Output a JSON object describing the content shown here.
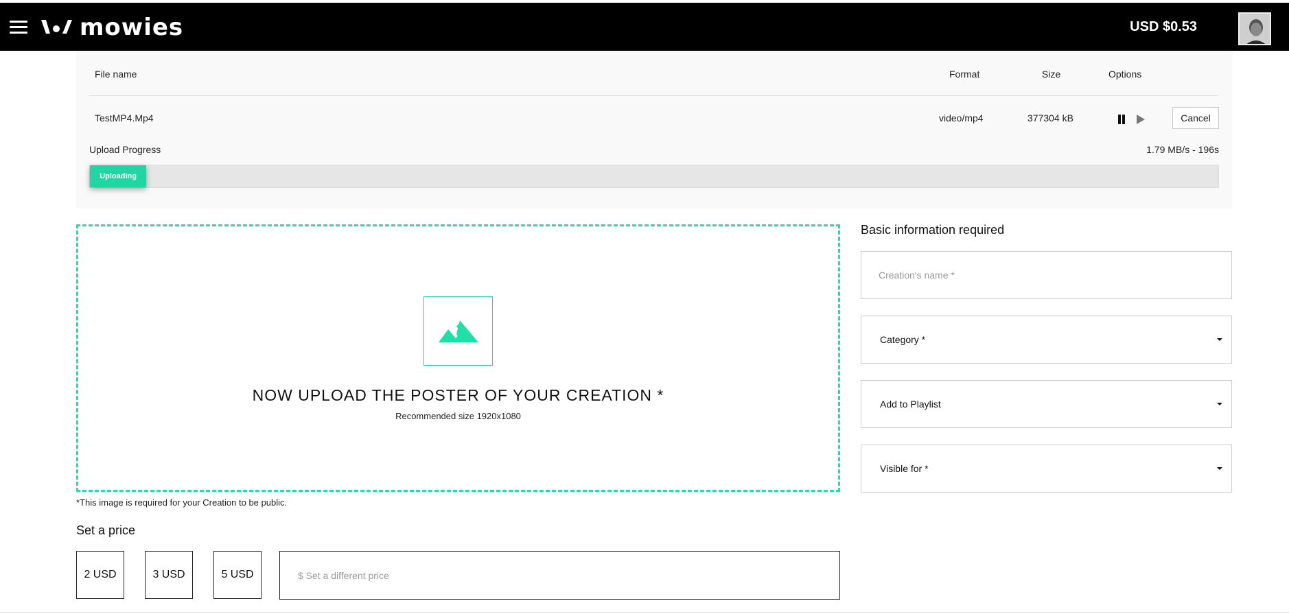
{
  "header": {
    "brand": "mowies",
    "balance": "USD $0.53"
  },
  "upload_table": {
    "columns": {
      "file_name": "File name",
      "format": "Format",
      "size": "Size",
      "options": "Options"
    },
    "row": {
      "file_name": "TestMP4.Mp4",
      "format": "video/mp4",
      "size": "377304 kB",
      "cancel_label": "Cancel"
    },
    "progress": {
      "label": "Upload Progress",
      "rate": "1.79 MB/s - 196s",
      "status": "Uploading",
      "fraction": 0.05
    }
  },
  "poster": {
    "title": "NOW UPLOAD THE POSTER OF YOUR CREATION *",
    "subtitle": "Recommended size 1920x1080",
    "note": "*This image is required for your Creation to be public."
  },
  "price": {
    "title": "Set a price",
    "options": [
      "2 USD",
      "3 USD",
      "5 USD"
    ],
    "custom_placeholder": "$ Set a different price"
  },
  "basic_info": {
    "title": "Basic information required",
    "name_placeholder": "Creation's name *",
    "category_label": "Category *",
    "playlist_label": "Add to Playlist",
    "visibility_label": "Visible for *"
  },
  "colors": {
    "accent": "#1fe0a6",
    "topbar": "#000000"
  },
  "icons": {
    "menu": "hamburger-icon",
    "poster": "mountain-image-icon",
    "pause": "pause-icon",
    "play": "play-icon",
    "caret": "chevron-down-icon"
  }
}
